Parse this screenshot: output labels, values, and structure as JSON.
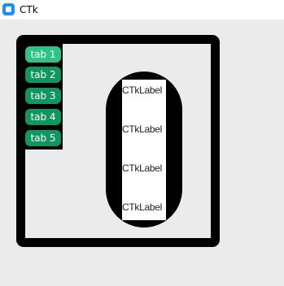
{
  "window": {
    "title": "CTk"
  },
  "tabs": [
    {
      "label": "tab 1",
      "active": true
    },
    {
      "label": "tab 2",
      "active": false
    },
    {
      "label": "tab 3",
      "active": false
    },
    {
      "label": "tab 4",
      "active": false
    },
    {
      "label": "tab 5",
      "active": false
    }
  ],
  "labels": [
    "CTkLabel",
    "CTkLabel",
    "CTkLabel",
    "CTkLabel"
  ],
  "colors": {
    "background": "#ebebeb",
    "frame": "#000000",
    "tab_active": "#2fc486",
    "tab_inactive": "#10965e"
  }
}
